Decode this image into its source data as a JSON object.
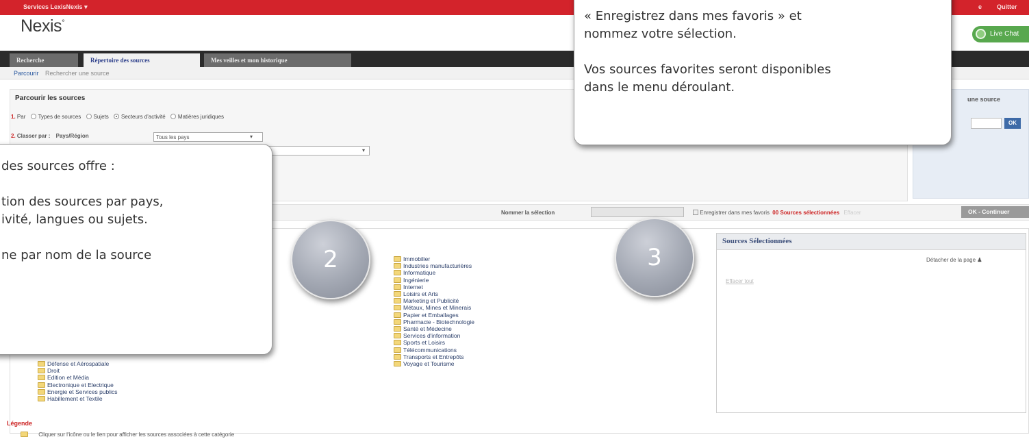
{
  "topbar": {
    "services_menu": "Services LexisNexis ▾",
    "quit": "Quitter",
    "partial_link": "e"
  },
  "logo": {
    "text": "Nexis",
    "mark": "°"
  },
  "livechat": {
    "label": "Live Chat"
  },
  "nav": {
    "tabs": [
      "Recherche",
      "Répertoire des sources",
      "Mes veilles et mon historique"
    ]
  },
  "subnav": {
    "items": [
      "Parcourir",
      "Rechercher une source"
    ]
  },
  "browse": {
    "title": "Parcourir les sources",
    "step1_num": "1.",
    "step1_label": "Par",
    "options": [
      "Types de sources",
      "Sujets",
      "Secteurs d'activité",
      "Matières juridiques"
    ],
    "selected_option": "Secteurs d'activité",
    "step2_num": "2.",
    "step2_label": "Classer par :",
    "step2_field": "Pays/Région",
    "country_select": "Tous les pays"
  },
  "right_panel": {
    "title": "une source",
    "ok": "OK"
  },
  "selection_bar": {
    "name_label": "Nommer la sélection",
    "save_checkbox": "Enregistrer dans mes favoris",
    "count": "00",
    "count_label": "Sources sélectionnées",
    "clear": "Effacer",
    "ok_continue": "OK - Continuer"
  },
  "categories_left": [
    "Défense et Aérospatiale",
    "Droit",
    "Edition et Média",
    "Electronique et Electrique",
    "Energie et Services publics",
    "Habillement et Textile"
  ],
  "categories_mid": [
    "Immobilier",
    "Industries manufacturières",
    "Informatique",
    "Ingénierie",
    "Internet",
    "Loisirs et Arts",
    "Marketing et Publicité",
    "Métaux, Mines et Minerais",
    "Papier et Emballages",
    "Pharmacie - Biotechnologie",
    "Santé et Médecine",
    "Services d'information",
    "Sports et Loisirs",
    "Télécommunications",
    "Transports et Entrepôts",
    "Voyage et Tourisme"
  ],
  "selected_sources": {
    "title": "Sources Sélectionnées",
    "detach": "Détacher de la page",
    "clear": "Effacer tout"
  },
  "legend": {
    "title": "Légende",
    "text": "Cliquer sur l'icône ou le lien pour afficher les sources associées à cette catégorie"
  },
  "callout_top": {
    "line1": "« Enregistrez dans mes favoris » et",
    "line2": "nommez votre sélection.",
    "line3": "Vos sources favorites seront disponibles",
    "line4": "dans le menu déroulant."
  },
  "callout_left": {
    "line1": "des sources offre :",
    "line2": "tion des sources par pays,",
    "line3": "ivité, langues ou sujets.",
    "line4": "ne par nom de la source"
  },
  "badges": {
    "two": "2",
    "three": "3"
  }
}
